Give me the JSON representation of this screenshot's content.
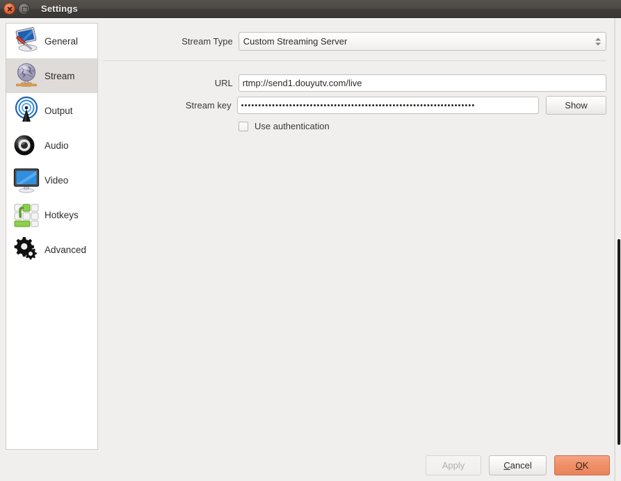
{
  "window": {
    "title": "Settings",
    "close_icon": "close-icon",
    "maximize_icon": "maximize-icon"
  },
  "sidebar": {
    "items": [
      {
        "label": "General",
        "icon": "general-monitor-screwdriver-icon",
        "selected": false
      },
      {
        "label": "Stream",
        "icon": "stream-globe-icon",
        "selected": true
      },
      {
        "label": "Output",
        "icon": "output-broadcast-antenna-icon",
        "selected": false
      },
      {
        "label": "Audio",
        "icon": "audio-speaker-icon",
        "selected": false
      },
      {
        "label": "Video",
        "icon": "video-monitor-icon",
        "selected": false
      },
      {
        "label": "Hotkeys",
        "icon": "hotkeys-keyboard-icon",
        "selected": false
      },
      {
        "label": "Advanced",
        "icon": "advanced-gears-icon",
        "selected": false
      }
    ]
  },
  "form": {
    "stream_type": {
      "label": "Stream Type",
      "value": "Custom Streaming Server",
      "spinner_icon": "spinner-updown-icon"
    },
    "url": {
      "label": "URL",
      "value": "rtmp://send1.douyutv.com/live",
      "placeholder": ""
    },
    "stream_key": {
      "label": "Stream key",
      "value": "••••••••••••••••••••••••••••••••••••••••••••••••••••••••••••••••••••",
      "show_button_label": "Show"
    },
    "use_authentication": {
      "label": "Use authentication",
      "checked": false
    }
  },
  "footer": {
    "apply_label": "Apply",
    "apply_enabled": false,
    "cancel_label": "Cancel",
    "cancel_mnemonic": "C",
    "ok_label": "OK",
    "ok_mnemonic": "O"
  },
  "colors": {
    "titlebar": "#4b4845",
    "dialog_bg": "#f1efee",
    "selected_item": "#dedbd8",
    "primary_button": "#ef8f68",
    "close_button": "#e1673a"
  }
}
